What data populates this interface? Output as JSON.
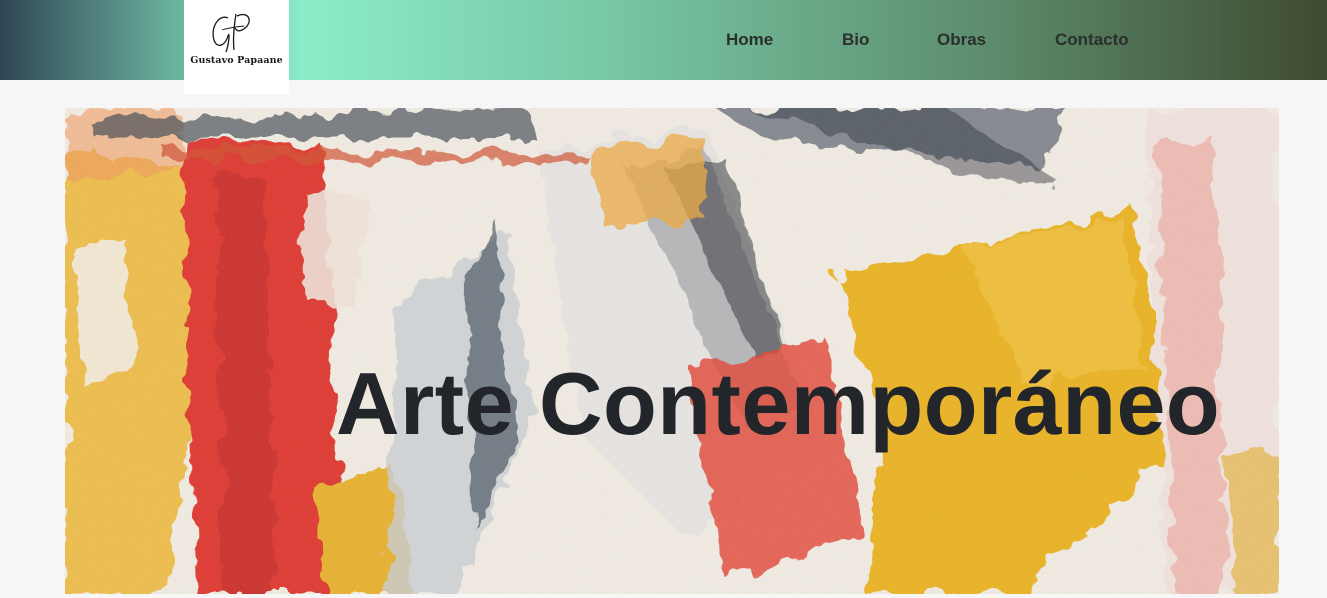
{
  "brand": {
    "monogram": "GP",
    "name": "Gustavo Papaane"
  },
  "nav": {
    "items": [
      {
        "label": "Home"
      },
      {
        "label": "Bio"
      },
      {
        "label": "Obras"
      },
      {
        "label": "Contacto"
      }
    ]
  },
  "hero": {
    "title": "Arte Contemporáneo",
    "image": "abstract-painting-image"
  },
  "colors": {
    "nav_gradient_start": "#2f4754",
    "nav_gradient_mint": "#8cecc9",
    "nav_gradient_end": "#3f4a30",
    "title_text": "#22262b",
    "nav_text": "#2a2f2c",
    "page_background": "#f7f6f6"
  }
}
